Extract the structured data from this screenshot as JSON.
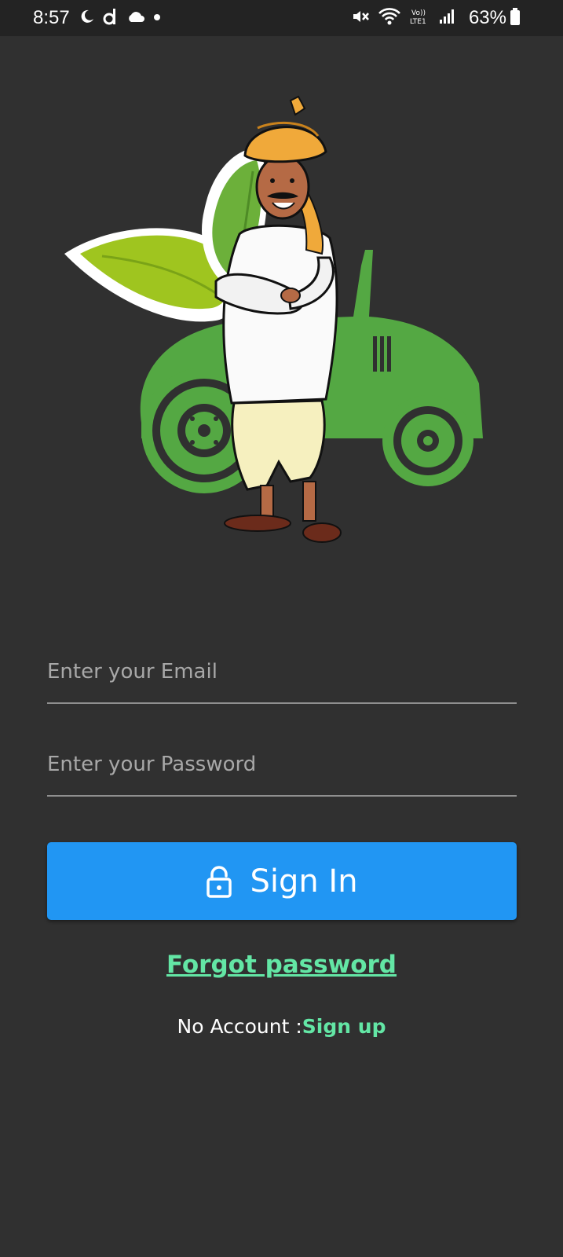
{
  "status_bar": {
    "time": "8:57",
    "battery_percent": "63%",
    "network_label": "Vo)) LTE1",
    "left_icons": [
      "moon-icon",
      "d-app-icon",
      "cloud-icon",
      "dot-icon"
    ],
    "right_icons": [
      "vibrate-mute-icon",
      "wifi-icon",
      "volte-icon",
      "signal-icon",
      "battery-icon"
    ]
  },
  "illustration": {
    "icon": "farmer-with-tractor-and-leaves-illustration",
    "colors": {
      "tractor": "#54a843",
      "leaf_light": "#9fc51f",
      "leaf_dark": "#6cb03a",
      "turban": "#f0a93a",
      "kurta": "#fafafa",
      "dhoti": "#f6f0bf"
    }
  },
  "login_form": {
    "email_placeholder": "Enter your Email",
    "email_value": "",
    "password_placeholder": "Enter your Password",
    "password_value": "",
    "sign_in_label": "Sign In",
    "sign_in_icon": "lock-icon",
    "forgot_password_label": "Forgot password",
    "no_account_label": "No Account :",
    "sign_up_label": "Sign up"
  },
  "colors": {
    "background": "#303030",
    "status_bar": "#232323",
    "primary_button": "#2196f3",
    "link": "#63e6a5",
    "input_underline": "#8f8f8f"
  }
}
